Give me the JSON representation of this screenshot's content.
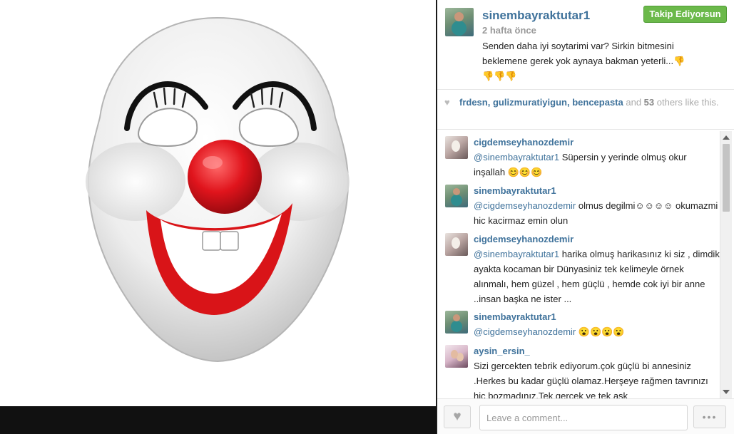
{
  "post": {
    "owner": "sinembayraktutar1",
    "time": "2 hafta önce",
    "follow_label": "Takip Ediyorsun",
    "caption": "Senden daha iyi soytarimi var? Sirkin bitmesini beklemene gerek yok aynaya bakman yeterli...👎👎👎👎"
  },
  "likes": {
    "liker_1": "frdesn",
    "sep_1": ", ",
    "liker_2": "gulizmuratiyigun",
    "sep_2": ", ",
    "liker_3": "bencepasta",
    "and_text": " and ",
    "count": "53",
    "others_text": " others like this."
  },
  "comments": [
    {
      "user": "cigdemseyhanozdemir",
      "mention": "@sinembayraktutar1",
      "text": " Süpersin y yerinde olmuş okur inşallah 😊😊😊"
    },
    {
      "user": "sinembayraktutar1",
      "mention": "@cigdemseyhanozdemir",
      "text": " olmus degilmi☺☺☺☺ okumazmi hic kacirmaz emin olun"
    },
    {
      "user": "cigdemseyhanozdemir",
      "mention": "@sinembayraktutar1",
      "text": " harika olmuş harikasınız ki siz , dimdik ayakta kocaman bir Dünyasiniz tek kelimeyle örnek alınmalı, hem güzel , hem güçlü , hemde cok iyi bir anne ..insan başka ne ister ..."
    },
    {
      "user": "sinembayraktutar1",
      "mention": "@cigdemseyhanozdemir",
      "text": " 😮😮😮😮"
    },
    {
      "user": "aysin_ersin_",
      "mention": "",
      "text": "Sizi gercekten tebrik ediyorum.çok güçlü bi annesiniz .Herkes bu kadar güçlü olamaz.Herşeye rağmen tavrınızı hiç bozmadınız.Tek gerçek ve tek aşk"
    }
  ],
  "footer": {
    "comment_placeholder": "Leave a comment...",
    "more_label": "•••"
  },
  "colors": {
    "username": "#3f729b",
    "follow_button": "#6bb94a",
    "clown_nose": "#e0141c"
  },
  "icons": {
    "like": "heart-icon",
    "more": "dots-icon",
    "scroll_up": "arrow-up-icon",
    "scroll_down": "arrow-down-icon"
  }
}
